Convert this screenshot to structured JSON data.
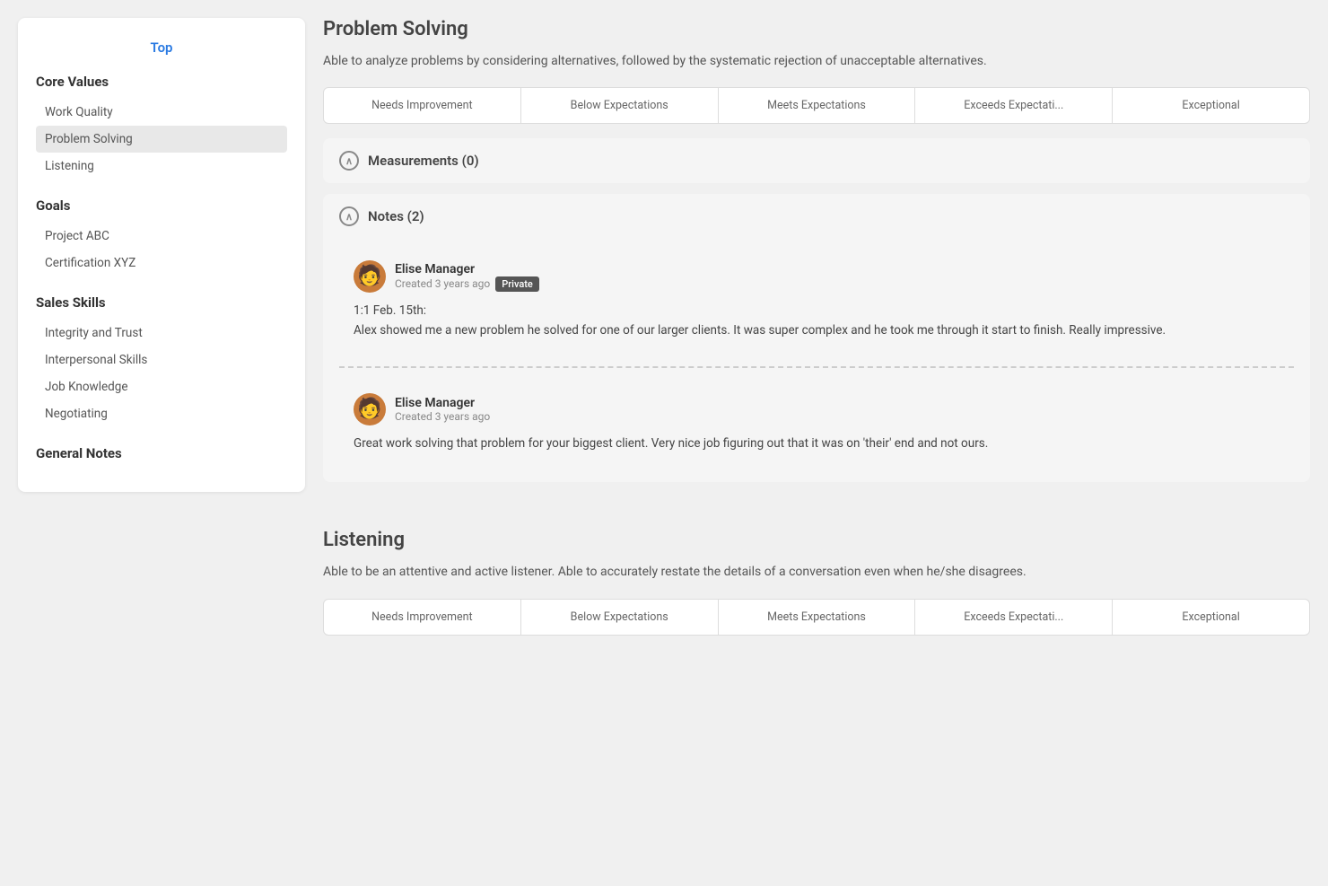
{
  "sidebar": {
    "top_label": "Top",
    "sections": [
      {
        "title": "Core Values",
        "items": [
          {
            "label": "Work Quality",
            "active": false
          },
          {
            "label": "Problem Solving",
            "active": true
          },
          {
            "label": "Listening",
            "active": false
          }
        ]
      },
      {
        "title": "Goals",
        "items": [
          {
            "label": "Project ABC",
            "active": false
          },
          {
            "label": "Certification XYZ",
            "active": false
          }
        ]
      },
      {
        "title": "Sales Skills",
        "items": [
          {
            "label": "Integrity and Trust",
            "active": false
          },
          {
            "label": "Interpersonal Skills",
            "active": false
          },
          {
            "label": "Job Knowledge",
            "active": false
          },
          {
            "label": "Negotiating",
            "active": false
          }
        ]
      },
      {
        "title": "General Notes",
        "items": []
      }
    ]
  },
  "problem_solving": {
    "title": "Problem Solving",
    "description": "Able to analyze problems by considering alternatives, followed by the systematic rejection of unacceptable alternatives.",
    "rating_options": [
      "Needs Improvement",
      "Below Expectations",
      "Meets Expectations",
      "Exceeds Expectati...",
      "Exceptional"
    ],
    "measurements_label": "Measurements (0)",
    "notes_label": "Notes (2)",
    "notes": [
      {
        "author": "Elise Manager",
        "created": "Created 3 years ago",
        "badge": "Private",
        "text_line1": "1:1 Feb. 15th:",
        "text_body": "Alex showed me a new problem he solved for one of our larger clients. It was super complex and he took me through it start to finish. Really impressive."
      },
      {
        "author": "Elise Manager",
        "created": "Created 3 years ago",
        "badge": null,
        "text_body": "Great work solving that problem for your biggest client. Very nice job figuring out that it was on 'their' end and not ours."
      }
    ]
  },
  "listening": {
    "title": "Listening",
    "description": "Able to be an attentive and active listener. Able to accurately restate the details of a conversation even when he/she disagrees.",
    "rating_options": [
      "Needs Improvement",
      "Below Expectations",
      "Meets Expectations",
      "Exceeds Expectati...",
      "Exceptional"
    ]
  },
  "icons": {
    "chevron_up": "∧",
    "avatar_emoji": "🧑"
  }
}
